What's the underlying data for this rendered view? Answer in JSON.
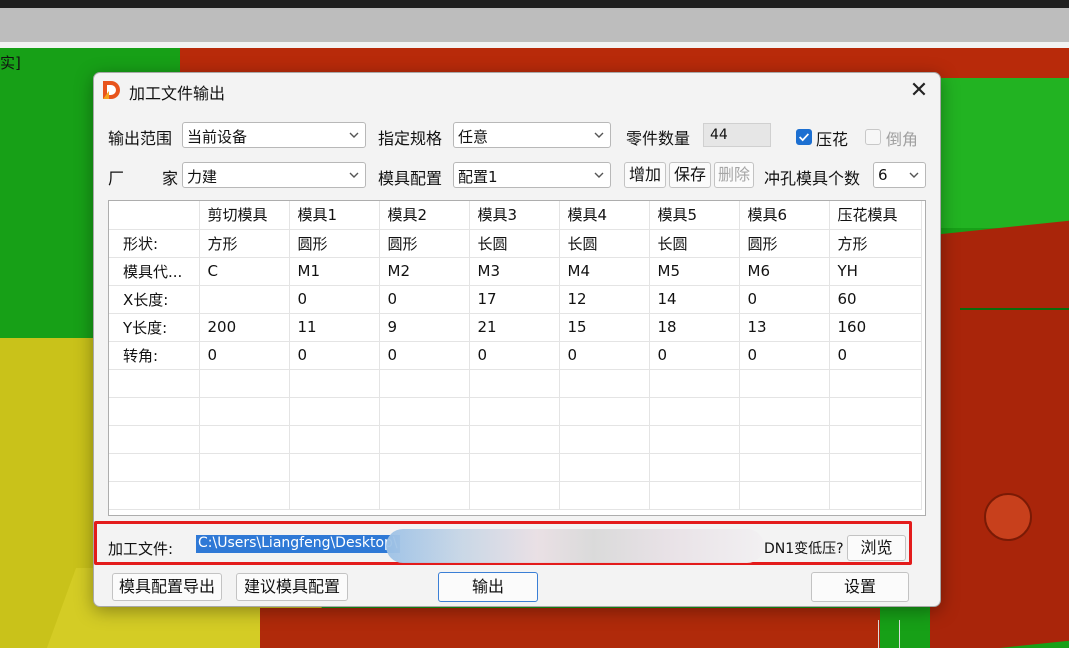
{
  "background": {
    "corner_label": "实]"
  },
  "dialog": {
    "title": "加工文件输出",
    "close": "✕",
    "row1": {
      "output_range_label": "输出范围",
      "output_range_value": "当前设备",
      "spec_label": "指定规格",
      "spec_value": "任意",
      "parts_count_label": "零件数量",
      "parts_count_value": "44",
      "emboss_label": "压花",
      "emboss_checked": true,
      "chamfer_label": "倒角",
      "chamfer_checked": false
    },
    "row2": {
      "vendor_label_a": "厂",
      "vendor_label_b": "家",
      "vendor_value": "力建",
      "mold_config_label": "模具配置",
      "mold_config_value": "配置1",
      "add_button": "增加",
      "save_button": "保存",
      "delete_button": "删除",
      "punch_count_label": "冲孔模具个数",
      "punch_count_value": "6"
    },
    "table": {
      "headers": [
        "",
        "剪切模具",
        "模具1",
        "模具2",
        "模具3",
        "模具4",
        "模具5",
        "模具6",
        "压花模具"
      ],
      "rows": [
        [
          "形状:",
          "方形",
          "圆形",
          "圆形",
          "长圆",
          "长圆",
          "长圆",
          "圆形",
          "方形"
        ],
        [
          "模具代...",
          "C",
          "M1",
          "M2",
          "M3",
          "M4",
          "M5",
          "M6",
          "YH"
        ],
        [
          "X长度:",
          "",
          "0",
          "0",
          "17",
          "12",
          "14",
          "0",
          "60"
        ],
        [
          "Y长度:",
          "200",
          "11",
          "9",
          "21",
          "15",
          "18",
          "13",
          "160"
        ],
        [
          "转角:",
          "0",
          "0",
          "0",
          "0",
          "0",
          "0",
          "0",
          "0"
        ]
      ],
      "empty_rows": 5
    },
    "file": {
      "label": "加工文件:",
      "path_visible": "C:\\Users\\Liangfeng\\Desktop\\",
      "path_tail": "DN1变低压?",
      "browse_button": "浏览"
    },
    "footer": {
      "export_config_button": "模具配置导出",
      "suggest_config_button": "建议模具配置",
      "output_button": "输出",
      "settings_button": "设置"
    }
  }
}
